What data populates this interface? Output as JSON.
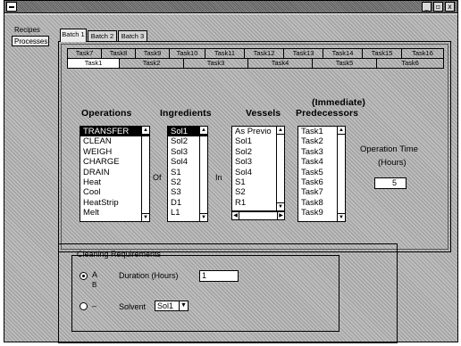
{
  "window": {
    "controls": {
      "minimize": "_",
      "maximize": "▫",
      "close": "x"
    }
  },
  "side_tabs": [
    "Recipes",
    "Processes"
  ],
  "batch_tabs": [
    "Batch 1",
    "Batch 2",
    "Batch 3"
  ],
  "task_tabs_row1": [
    "Task7",
    "Task8",
    "Task9",
    "Task10",
    "Task11",
    "Task12",
    "Task13",
    "Task14",
    "Task15",
    "Task16"
  ],
  "task_tabs_row2": [
    "Task1",
    "Task2",
    "Task3",
    "Task4",
    "Task5",
    "Task6"
  ],
  "columns": {
    "operations": "Operations",
    "ingredients": "Ingredients",
    "vessels": "Vessels",
    "predecessors_line1": "(Immediate)",
    "predecessors_line2": "Predecessors"
  },
  "operations_list": [
    "TRANSFER",
    "CLEAN",
    "WEIGH",
    "CHARGE",
    "DRAIN",
    "Heat",
    "Cool",
    "HeatStrip",
    "Melt"
  ],
  "operations_selected": "TRANSFER",
  "ingredients_list": [
    "Sol1",
    "Sol2",
    "Sol3",
    "Sol4",
    "S1",
    "S2",
    "S3",
    "D1",
    "L1"
  ],
  "ingredients_selected": "Sol1",
  "vessels_list": [
    "As Previo",
    "Sol1",
    "Sol2",
    "Sol3",
    "Sol4",
    "S1",
    "S2",
    "R1"
  ],
  "predecessors_list": [
    "Task1",
    "Task2",
    "Task3",
    "Task4",
    "Task5",
    "Task6",
    "Task7",
    "Task8",
    "Task9"
  ],
  "connector_of": "Of",
  "connector_in": "In",
  "operation_time": {
    "label": "Operation Time",
    "unit": "(Hours)",
    "value": "5"
  },
  "cleaning": {
    "title": "Cleaning Requirements",
    "option1": "A",
    "option1_sub": "B",
    "duration_label": "Duration (Hours)",
    "duration_value": "1",
    "solvent_label": "Solvent",
    "solvent_value": "Sol1"
  }
}
